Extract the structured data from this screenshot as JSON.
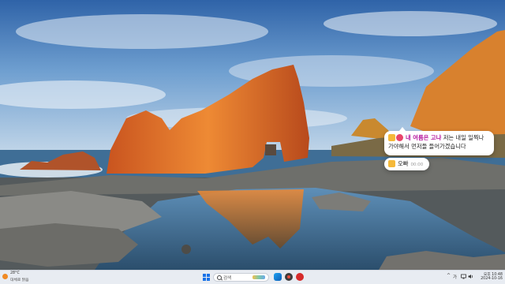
{
  "desktop": {
    "wallpaper": "coastal red rock arch at sunset with tide pool reflection"
  },
  "chat_widget": {
    "title": "내 여름은 고냐",
    "message_line1": "저는 내일 일찍나",
    "message_line2": "가야해서 먼저들 들어가겠습니다",
    "accent_color": "#b5179e"
  },
  "time_widget": {
    "label": "오빠",
    "time": "00:00"
  },
  "taskbar": {
    "weather": {
      "temperature": "28°C",
      "condition": "대체로 맑음"
    },
    "search_placeholder": "검색",
    "tray_ime": "가",
    "clock_time": "오후 10:48",
    "clock_date": "2024-10-16"
  },
  "colors": {
    "taskbar_bg": "#e8ecf2",
    "start_blue": "#1a73e8",
    "rock_orange": "#e0752a",
    "sky_blue": "#4f86c2"
  }
}
